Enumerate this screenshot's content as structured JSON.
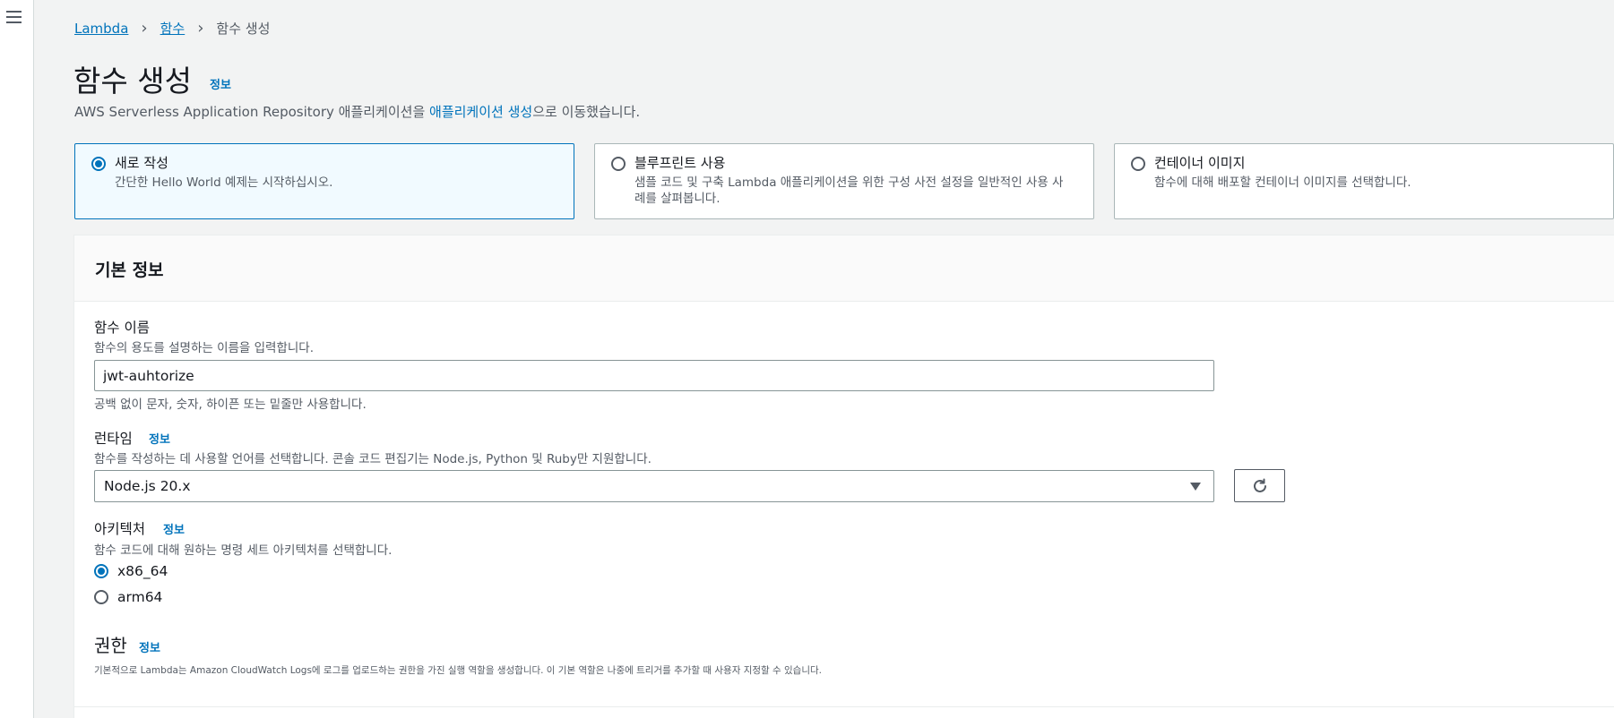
{
  "nav": {
    "menu_icon": "hamburger-menu-icon"
  },
  "breadcrumb": {
    "items": [
      "Lambda",
      "함수"
    ],
    "current": "함수 생성"
  },
  "header": {
    "title": "함수 생성",
    "info": "정보",
    "subtitle_prefix": "AWS Serverless Application Repository 애플리케이션을 ",
    "subtitle_link": "애플리케이션 생성",
    "subtitle_suffix": "으로 이동했습니다."
  },
  "options": [
    {
      "title": "새로 작성",
      "desc": "간단한 Hello World 예제는 시작하십시오.",
      "selected": true
    },
    {
      "title": "블루프린트 사용",
      "desc": "샘플 코드 및 구축 Lambda 애플리케이션을 위한 구성 사전 설정을 일반적인 사용 사례를 살펴봅니다.",
      "selected": false
    },
    {
      "title": "컨테이너 이미지",
      "desc": "함수에 대해 배포할 컨테이너 이미지를 선택합니다.",
      "selected": false
    }
  ],
  "basic": {
    "title": "기본 정보",
    "function_name": {
      "label": "함수 이름",
      "desc": "함수의 용도를 설명하는 이름을 입력합니다.",
      "value": "jwt-auhtorize",
      "hint": "공백 없이 문자, 숫자, 하이픈 또는 밑줄만 사용합니다."
    },
    "runtime": {
      "label": "런타임",
      "info": "정보",
      "desc": "함수를 작성하는 데 사용할 언어를 선택합니다. 콘솔 코드 편집기는 Node.js, Python 및 Ruby만 지원합니다.",
      "value": "Node.js 20.x",
      "refresh_icon": "refresh-icon"
    },
    "architecture": {
      "label": "아키텍처",
      "info": "정보",
      "desc": "함수 코드에 대해 원하는 명령 세트 아키텍처를 선택합니다.",
      "options": [
        {
          "label": "x86_64",
          "selected": true
        },
        {
          "label": "arm64",
          "selected": false
        }
      ]
    },
    "permissions": {
      "title": "권한",
      "info": "정보",
      "desc": "기본적으로 Lambda는 Amazon CloudWatch Logs에 로그를 업로드하는 권한을 가진 실행 역할을 생성합니다. 이 기본 역할은 나중에 트리거를 추가할 때 사용자 지정할 수 있습니다."
    }
  },
  "colors": {
    "accent": "#0073bb",
    "background": "#f2f3f3",
    "text": "#16191f",
    "muted": "#545b64"
  }
}
